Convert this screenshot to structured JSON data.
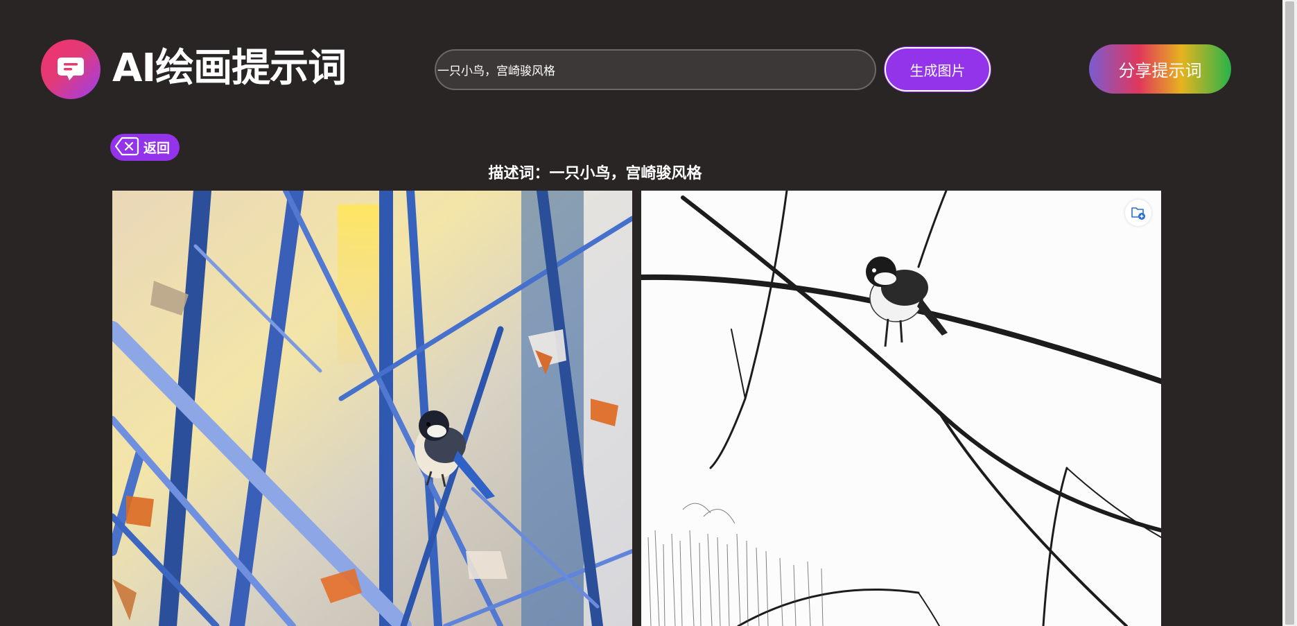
{
  "header": {
    "app_title": "AI绘画提示词",
    "search_value": "一只小鸟，宫崎骏风格",
    "search_placeholder": "",
    "generate_label": "生成图片",
    "share_label": "分享提示词"
  },
  "detail": {
    "back_label": "返回",
    "prompt_line": "描述词：一只小鸟，宫崎骏风格"
  },
  "colors": {
    "page_bg": "#2a2525",
    "accent_purple": "#9333ea",
    "logo_pink": "#f2346e"
  },
  "icons": {
    "logo": "chat-bubble-icon",
    "back": "backspace-x-icon",
    "favorite": "favorite-add-icon"
  }
}
